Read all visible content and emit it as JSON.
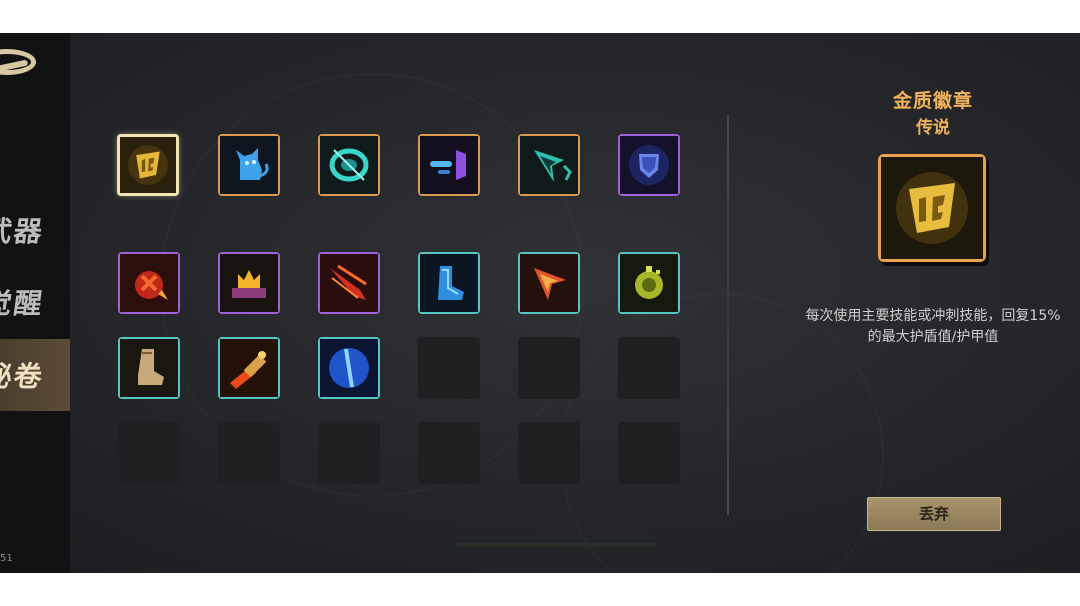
{
  "sidebar": {
    "tabs": [
      {
        "label": "武器",
        "active": false
      },
      {
        "label": "觉醒",
        "active": false
      },
      {
        "label": "秘卷",
        "active": true
      }
    ],
    "version": "51"
  },
  "inventory": {
    "slots": [
      {
        "icon": "gold-badge-icon",
        "rarity": "gold",
        "selected": true
      },
      {
        "icon": "blue-cat-icon",
        "rarity": "gold"
      },
      {
        "icon": "cyan-ring-icon",
        "rarity": "gold"
      },
      {
        "icon": "purple-dash-icon",
        "rarity": "gold"
      },
      {
        "icon": "cyan-arrowhead-icon",
        "rarity": "gold"
      },
      {
        "icon": "blue-shield-icon",
        "rarity": "purple"
      },
      {
        "icon": "red-flame-icon",
        "rarity": "purple"
      },
      {
        "icon": "gold-crown-icon",
        "rarity": "purple"
      },
      {
        "icon": "red-claw-icon",
        "rarity": "purple"
      },
      {
        "icon": "blue-boot-icon",
        "rarity": "cyan"
      },
      {
        "icon": "red-arrowhead-icon",
        "rarity": "cyan"
      },
      {
        "icon": "green-ring-icon",
        "rarity": "cyan"
      },
      {
        "icon": "leather-boot-icon",
        "rarity": "cyan"
      },
      {
        "icon": "fire-rocket-icon",
        "rarity": "cyan"
      },
      {
        "icon": "blue-orb-icon",
        "rarity": "cyan"
      },
      {
        "icon": "",
        "rarity": "empty"
      },
      {
        "icon": "",
        "rarity": "empty"
      },
      {
        "icon": "",
        "rarity": "empty"
      },
      {
        "icon": "",
        "rarity": "empty"
      },
      {
        "icon": "",
        "rarity": "empty"
      },
      {
        "icon": "",
        "rarity": "empty"
      },
      {
        "icon": "",
        "rarity": "empty"
      },
      {
        "icon": "",
        "rarity": "empty"
      },
      {
        "icon": "",
        "rarity": "empty"
      }
    ]
  },
  "detail": {
    "name": "金质徽章",
    "rarity": "传说",
    "icon": "gold-badge-icon",
    "description": "每次使用主要技能或冲刺技能，回复15%的最大护盾值/护甲值",
    "discard_label": "丢弃"
  },
  "colors": {
    "gold": "#d99a4c",
    "purple": "#9e62d9",
    "cyan": "#53c5c2",
    "title": "#f0b35a"
  }
}
